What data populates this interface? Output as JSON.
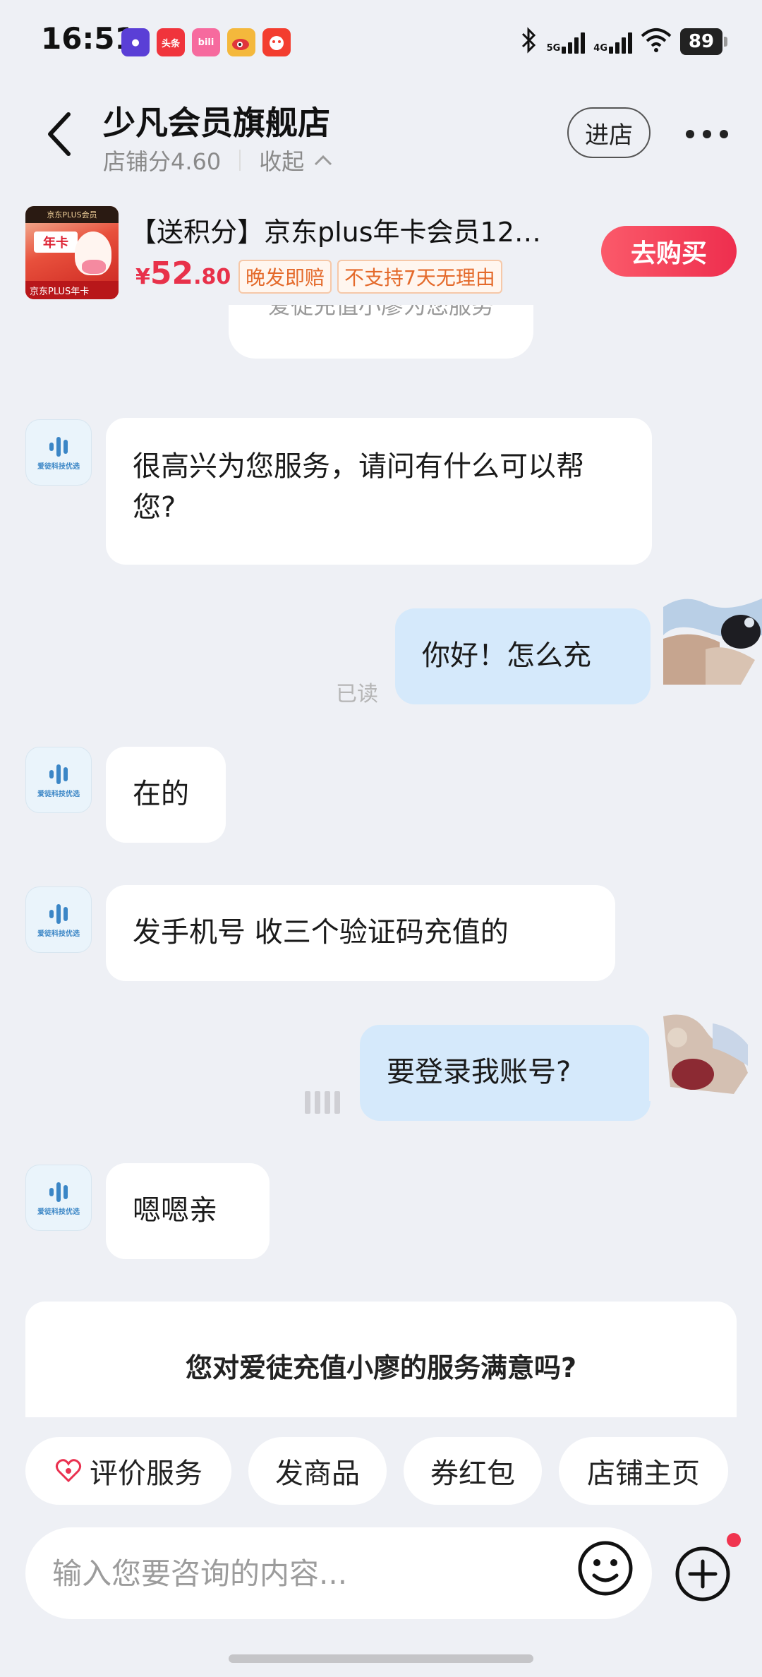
{
  "status_bar": {
    "time": "16:51",
    "notifications": [
      {
        "name": "app-astronaut-icon",
        "label": "",
        "color": "#5a3fd6"
      },
      {
        "name": "app-toutiao-icon",
        "label": "头条",
        "color": "#f0343c"
      },
      {
        "name": "app-bilibili-icon",
        "label": "bili",
        "color": "#f66a9e"
      },
      {
        "name": "app-weibo-icon",
        "label": "",
        "color": "#f4b83c"
      },
      {
        "name": "app-taobao-icon",
        "label": "",
        "color": "#f33d2f"
      }
    ],
    "network_1": "5G",
    "network_2": "4G",
    "battery": "89"
  },
  "header": {
    "shop_name": "少凡会员旗舰店",
    "shop_score": "店铺分4.60",
    "collapse_label": "收起",
    "enter_store": "进店"
  },
  "product": {
    "title": "【送积分】京东plus年卡会员12…",
    "price_symbol": "¥",
    "price_int": "52",
    "price_dec": ".80",
    "tags": [
      "晚发即赔",
      "不支持7天无理由"
    ],
    "buy_label": "去购买",
    "image_strip": "京东PLUS会员",
    "image_badge": "年卡",
    "image_bottom": "京东PLUS年卡"
  },
  "system_notice": "爱徒充值小廖为您服务",
  "messages": [
    {
      "side": "left",
      "text": "很高兴为您服务，请问有什么可以帮您?"
    },
    {
      "side": "right",
      "text": "你好！怎么充",
      "status": "已读"
    },
    {
      "side": "left",
      "text": "在的"
    },
    {
      "side": "left",
      "text": "发手机号 收三个验证码充值的"
    },
    {
      "side": "right",
      "text": "要登录我账号?"
    },
    {
      "side": "left",
      "text": "嗯嗯亲"
    }
  ],
  "avatar_caption": "爱徒科技优选",
  "satisfaction_question": "您对爱徒充值小廖的服务满意吗?",
  "quick_actions": [
    "评价服务",
    "发商品",
    "券红包",
    "店铺主页"
  ],
  "input": {
    "placeholder": "输入您要咨询的内容..."
  },
  "colors": {
    "accent_red": "#ee2e4e",
    "bubble_right": "#d5e9fb",
    "background": "#eef0f5"
  }
}
